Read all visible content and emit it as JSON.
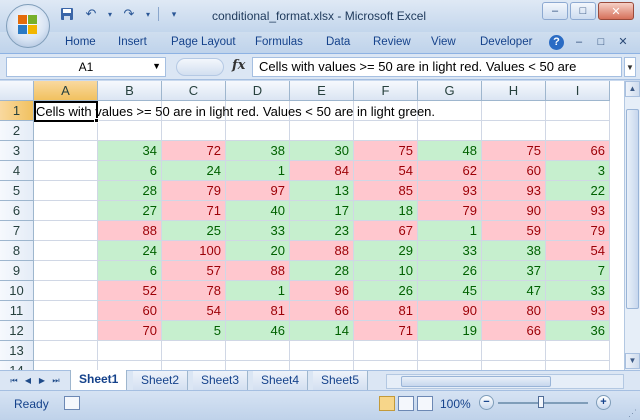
{
  "window": {
    "title": "conditional_format.xlsx - Microsoft Excel",
    "minimize_icon": "minimize-icon",
    "restore_icon": "restore-icon",
    "close_icon": "close-icon"
  },
  "ribbon": {
    "tabs": [
      "Home",
      "Insert",
      "Page Layout",
      "Formulas",
      "Data",
      "Review",
      "View",
      "Developer"
    ],
    "help_label": "?"
  },
  "formula_bar": {
    "name_box": "A1",
    "fx_label": "fx",
    "formula": "Cells with values >= 50 are in light red. Values < 50 are"
  },
  "grid": {
    "columns": [
      "A",
      "B",
      "C",
      "D",
      "E",
      "F",
      "G",
      "H",
      "I"
    ],
    "rows": [
      "1",
      "2",
      "3",
      "4",
      "5",
      "6",
      "7",
      "8",
      "9",
      "10",
      "11",
      "12",
      "13",
      "14"
    ],
    "a1_text": "Cells with values >= 50 are in light red. Values < 50 are in light green.",
    "data": [
      [
        34,
        72,
        38,
        30,
        75,
        48,
        75,
        66
      ],
      [
        6,
        24,
        1,
        84,
        54,
        62,
        60,
        3
      ],
      [
        28,
        79,
        97,
        13,
        85,
        93,
        93,
        22
      ],
      [
        27,
        71,
        40,
        17,
        18,
        79,
        90,
        93
      ],
      [
        88,
        25,
        33,
        23,
        67,
        1,
        59,
        79
      ],
      [
        24,
        100,
        20,
        88,
        29,
        33,
        38,
        54
      ],
      [
        6,
        57,
        88,
        28,
        10,
        26,
        37,
        7
      ],
      [
        52,
        78,
        1,
        96,
        26,
        45,
        47,
        33
      ],
      [
        60,
        54,
        81,
        66,
        81,
        90,
        80,
        93
      ],
      [
        70,
        5,
        46,
        14,
        71,
        19,
        66,
        36
      ]
    ],
    "threshold": 50,
    "high_fill": "#ffc7ce",
    "high_text": "#9c0006",
    "low_fill": "#c6efce",
    "low_text": "#006100"
  },
  "sheets": {
    "tabs": [
      "Sheet1",
      "Sheet2",
      "Sheet3",
      "Sheet4",
      "Sheet5"
    ],
    "active": "Sheet1"
  },
  "status": {
    "ready": "Ready",
    "zoom": "100%",
    "zoom_minus": "−",
    "zoom_plus": "+"
  }
}
